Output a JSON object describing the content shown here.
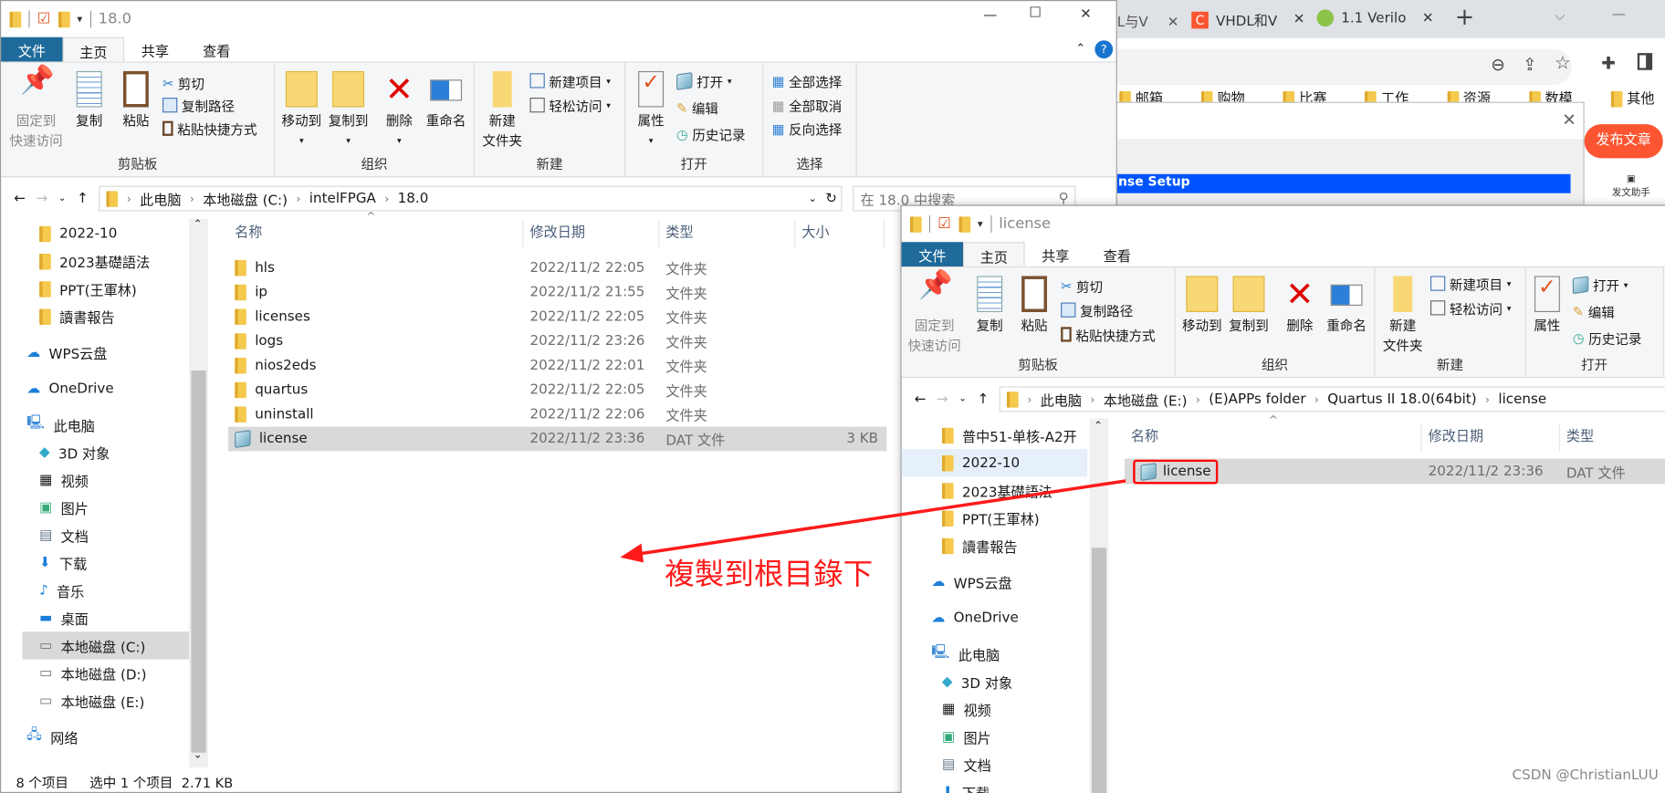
{
  "browser": {
    "tabs": [
      {
        "label": "L与V"
      },
      {
        "label": "VHDL和V"
      },
      {
        "label": "1.1 Verilo"
      }
    ],
    "new_tab": "+",
    "bookmarks": [
      "邮箱",
      "购物",
      "比赛",
      "工作",
      "资源",
      "数模",
      "其他"
    ],
    "publish_button": "发布文章",
    "assistant_label": "发文助手",
    "dialog_title_fragment": "nse Setup",
    "accent": "#fc5531"
  },
  "left_window": {
    "title": "18.0",
    "tabs": [
      "文件",
      "主页",
      "共享",
      "查看"
    ],
    "ribbon": {
      "pin": "固定到\n快速访问",
      "copy": "复制",
      "paste": "粘贴",
      "cut": "剪切",
      "copy_path": "复制路径",
      "paste_shortcut": "粘贴快捷方式",
      "clipboard": "剪贴板",
      "move_to": "移动到",
      "copy_to": "复制到",
      "delete": "删除",
      "rename": "重命名",
      "organize": "组织",
      "new_folder": "新建\n文件夹",
      "new_item": "新建项目",
      "easy_access": "轻松访问",
      "new": "新建",
      "properties": "属性",
      "open": "打开",
      "edit": "编辑",
      "history": "历史记录",
      "open_group": "打开",
      "select_all": "全部选择",
      "select_none": "全部取消",
      "invert": "反向选择",
      "select": "选择"
    },
    "breadcrumb": [
      "此电脑",
      "本地磁盘 (C:)",
      "intelFPGA",
      "18.0"
    ],
    "search_placeholder": "在 18.0 中搜索",
    "nav": [
      {
        "label": "2022-10",
        "icon": "folder-icon"
      },
      {
        "label": "2023基礎語法",
        "icon": "folder-icon"
      },
      {
        "label": "PPT(王軍林)",
        "icon": "folder-icon"
      },
      {
        "label": "讀書報告",
        "icon": "folder-icon"
      },
      {
        "label": "WPS云盘",
        "icon": "cloud-icon"
      },
      {
        "label": "OneDrive",
        "icon": "cloud-icon"
      },
      {
        "label": "此电脑",
        "icon": "computer-icon"
      },
      {
        "label": "3D 对象",
        "icon": "cube-icon"
      },
      {
        "label": "视频",
        "icon": "video-icon"
      },
      {
        "label": "图片",
        "icon": "picture-icon"
      },
      {
        "label": "文档",
        "icon": "document-icon"
      },
      {
        "label": "下载",
        "icon": "download-icon"
      },
      {
        "label": "音乐",
        "icon": "music-icon"
      },
      {
        "label": "桌面",
        "icon": "desktop-icon"
      },
      {
        "label": "本地磁盘 (C:)",
        "icon": "drive-icon"
      },
      {
        "label": "本地磁盘 (D:)",
        "icon": "drive-icon"
      },
      {
        "label": "本地磁盘 (E:)",
        "icon": "drive-icon"
      },
      {
        "label": "网络",
        "icon": "network-icon"
      }
    ],
    "columns": [
      "名称",
      "修改日期",
      "类型",
      "大小"
    ],
    "files": [
      {
        "name": "hls",
        "date": "2022/11/2 22:05",
        "type": "文件夹",
        "size": ""
      },
      {
        "name": "ip",
        "date": "2022/11/2 21:55",
        "type": "文件夹",
        "size": ""
      },
      {
        "name": "licenses",
        "date": "2022/11/2 22:05",
        "type": "文件夹",
        "size": ""
      },
      {
        "name": "logs",
        "date": "2022/11/2 23:26",
        "type": "文件夹",
        "size": ""
      },
      {
        "name": "nios2eds",
        "date": "2022/11/2 22:01",
        "type": "文件夹",
        "size": ""
      },
      {
        "name": "quartus",
        "date": "2022/11/2 22:05",
        "type": "文件夹",
        "size": ""
      },
      {
        "name": "uninstall",
        "date": "2022/11/2 22:06",
        "type": "文件夹",
        "size": ""
      },
      {
        "name": "license",
        "date": "2022/11/2 23:36",
        "type": "DAT 文件",
        "size": "3 KB"
      }
    ],
    "status": {
      "count": "8 个项目",
      "selected": "选中 1 个项目",
      "size": "2.71 KB"
    }
  },
  "right_window": {
    "title": "license",
    "tabs": [
      "文件",
      "主页",
      "共享",
      "查看"
    ],
    "breadcrumb": [
      "此电脑",
      "本地磁盘 (E:)",
      "(E)APPs folder",
      "Quartus II 18.0(64bit)",
      "license"
    ],
    "nav": [
      {
        "label": "普中51-单核-A2开",
        "icon": "folder-icon"
      },
      {
        "label": "2022-10",
        "icon": "folder-icon"
      },
      {
        "label": "2023基礎語法",
        "icon": "folder-icon"
      },
      {
        "label": "PPT(王軍林)",
        "icon": "folder-icon"
      },
      {
        "label": "讀書報告",
        "icon": "folder-icon"
      },
      {
        "label": "WPS云盘",
        "icon": "cloud-icon"
      },
      {
        "label": "OneDrive",
        "icon": "cloud-icon"
      },
      {
        "label": "此电脑",
        "icon": "computer-icon"
      },
      {
        "label": "3D 对象",
        "icon": "cube-icon"
      },
      {
        "label": "视频",
        "icon": "video-icon"
      },
      {
        "label": "图片",
        "icon": "picture-icon"
      },
      {
        "label": "文档",
        "icon": "document-icon"
      },
      {
        "label": "下载",
        "icon": "download-icon"
      }
    ],
    "columns": [
      "名称",
      "修改日期",
      "类型"
    ],
    "files": [
      {
        "name": "license",
        "date": "2022/11/2 23:36",
        "type": "DAT 文件"
      }
    ]
  },
  "annotation": {
    "text": "複製到根目錄下",
    "color": "#ff1a1a"
  },
  "watermark": "CSDN @ChristianLUU"
}
